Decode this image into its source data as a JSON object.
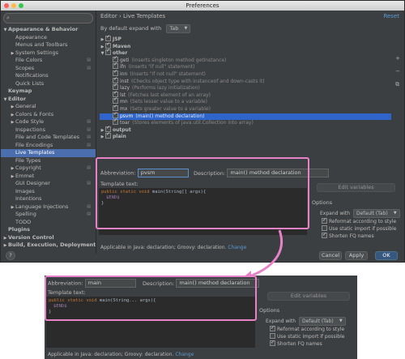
{
  "window": {
    "title": "Preferences"
  },
  "search": {
    "placeholder": ""
  },
  "sidebar": {
    "items": [
      {
        "label": "Appearance & Behavior",
        "level": 0,
        "arrow": "down",
        "bold": true
      },
      {
        "label": "Appearance",
        "level": 1
      },
      {
        "label": "Menus and Toolbars",
        "level": 1
      },
      {
        "label": "System Settings",
        "level": 1,
        "arrow": "right"
      },
      {
        "label": "File Colors",
        "level": 1,
        "page": true
      },
      {
        "label": "Scopes",
        "level": 1,
        "page": true
      },
      {
        "label": "Notifications",
        "level": 1
      },
      {
        "label": "Quick Lists",
        "level": 1
      },
      {
        "label": "Keymap",
        "level": 0,
        "bold": true
      },
      {
        "label": "Editor",
        "level": 0,
        "arrow": "down",
        "bold": true
      },
      {
        "label": "General",
        "level": 1,
        "arrow": "right"
      },
      {
        "label": "Colors & Fonts",
        "level": 1,
        "arrow": "right"
      },
      {
        "label": "Code Style",
        "level": 1,
        "arrow": "right",
        "page": true
      },
      {
        "label": "Inspections",
        "level": 1,
        "page": true
      },
      {
        "label": "File and Code Templates",
        "level": 1,
        "page": true
      },
      {
        "label": "File Encodings",
        "level": 1,
        "page": true
      },
      {
        "label": "Live Templates",
        "level": 1,
        "selected": true
      },
      {
        "label": "File Types",
        "level": 1
      },
      {
        "label": "Copyright",
        "level": 1,
        "arrow": "right",
        "page": true
      },
      {
        "label": "Emmet",
        "level": 1,
        "arrow": "right"
      },
      {
        "label": "GUI Designer",
        "level": 1,
        "page": true
      },
      {
        "label": "Images",
        "level": 1
      },
      {
        "label": "Intentions",
        "level": 1
      },
      {
        "label": "Language Injections",
        "level": 1,
        "arrow": "right",
        "page": true
      },
      {
        "label": "Spelling",
        "level": 1,
        "page": true
      },
      {
        "label": "TODO",
        "level": 1
      },
      {
        "label": "Plugins",
        "level": 0,
        "bold": true
      },
      {
        "label": "Version Control",
        "level": 0,
        "arrow": "right",
        "bold": true
      },
      {
        "label": "Build, Execution, Deployment",
        "level": 0,
        "arrow": "right",
        "bold": true
      }
    ]
  },
  "main": {
    "breadcrumb": "Editor › Live Templates",
    "reset": "Reset",
    "expand_label": "By default expand with",
    "expand_value": "Tab",
    "templates": [
      {
        "kind": "group",
        "name": "JSP",
        "open": false
      },
      {
        "kind": "group",
        "name": "Maven",
        "open": false
      },
      {
        "kind": "group",
        "name": "other",
        "open": true
      },
      {
        "kind": "item",
        "name": "geti",
        "desc": "(Inserts singleton method getInstance)"
      },
      {
        "kind": "item",
        "name": "ifn",
        "desc": "(Inserts \"if null\" statement)"
      },
      {
        "kind": "item",
        "name": "inn",
        "desc": "(Inserts \"if not null\" statement)"
      },
      {
        "kind": "item",
        "name": "inst",
        "desc": "(Checks object type with instanceof and down-casts it)"
      },
      {
        "kind": "item",
        "name": "lazy",
        "desc": "(Performs lazy initialization)"
      },
      {
        "kind": "item",
        "name": "lst",
        "desc": "(Fetches last element of an array)"
      },
      {
        "kind": "item",
        "name": "mn",
        "desc": "(Sets lesser value to a variable)"
      },
      {
        "kind": "item",
        "name": "mx",
        "desc": "(Sets greater value to a variable)"
      },
      {
        "kind": "item",
        "name": "psvm",
        "desc": "(main() method declaration)",
        "selected": true
      },
      {
        "kind": "item",
        "name": "toar",
        "desc": "(Stores elements of java.util.Collection into array)"
      },
      {
        "kind": "group",
        "name": "output",
        "open": false
      },
      {
        "kind": "group",
        "name": "plain",
        "open": false
      }
    ]
  },
  "editor": {
    "abbr_label": "Abbreviation:",
    "abbr_value": "pvsm",
    "desc_label": "Description:",
    "desc_value": "main() method declaration",
    "template_text_label": "Template text:",
    "code_line1_kw": "public static void ",
    "code_line1_rest": "main(String[] args){",
    "code_line2": "$END$",
    "code_line3": "}",
    "edit_variables": "Edit variables",
    "options_label": "Options",
    "expand_with_label": "Expand with",
    "expand_with_value": "Default (Tab)",
    "reformat": "Reformat according to style",
    "static_import": "Use static import if possible",
    "shorten_fq": "Shorten FQ names",
    "applicable": "Applicable in Java: declaration; Groovy: declaration.",
    "change": "Change"
  },
  "buttons": {
    "help": "?",
    "cancel": "Cancel",
    "apply": "Apply",
    "ok": "OK"
  },
  "zoom": {
    "abbr_label": "Abbreviation:",
    "abbr_value": "main",
    "desc_label": "Description:",
    "desc_value": "main() method declaration",
    "template_text_label": "Template text:",
    "code_line1_kw": "public static void ",
    "code_line1_rest": "main(String... args){",
    "code_line2": "$END$",
    "code_line3": "}",
    "edit_variables": "Edit variables",
    "options_label": "Options",
    "expand_with_label": "Expand with",
    "expand_with_value": "Default (Tab)",
    "reformat": "Reformat according to style",
    "static_import": "Use static import if possible",
    "shorten_fq": "Shorten FQ names",
    "applicable": "Applicable in Java: declaration; Groovy: declaration.",
    "change": "Change"
  },
  "colors": {
    "selection": "#2f65ca",
    "highlight": "#e882c8",
    "link": "#5a9bd5"
  }
}
